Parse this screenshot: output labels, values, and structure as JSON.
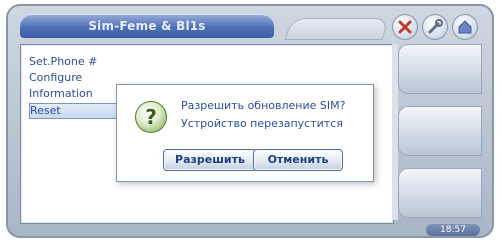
{
  "window": {
    "title": "Sim-Feme & Bl1s"
  },
  "menu": {
    "items": [
      {
        "label": "Set.Phone #"
      },
      {
        "label": "Configure"
      },
      {
        "label": "Information"
      },
      {
        "label": "Reset",
        "selected": true
      }
    ]
  },
  "dialog": {
    "icon": "question-icon",
    "line1": "Разрешить обновление SIM?",
    "line2": "Устройство перезапустится",
    "allow_label": "Разрешить",
    "cancel_label": "Отменить"
  },
  "status": {
    "clock": "18:57"
  },
  "colors": {
    "title_bar": "#4f6fb7",
    "text_blue": "#2b4f9e",
    "icon_green": "#5e8c3b"
  }
}
